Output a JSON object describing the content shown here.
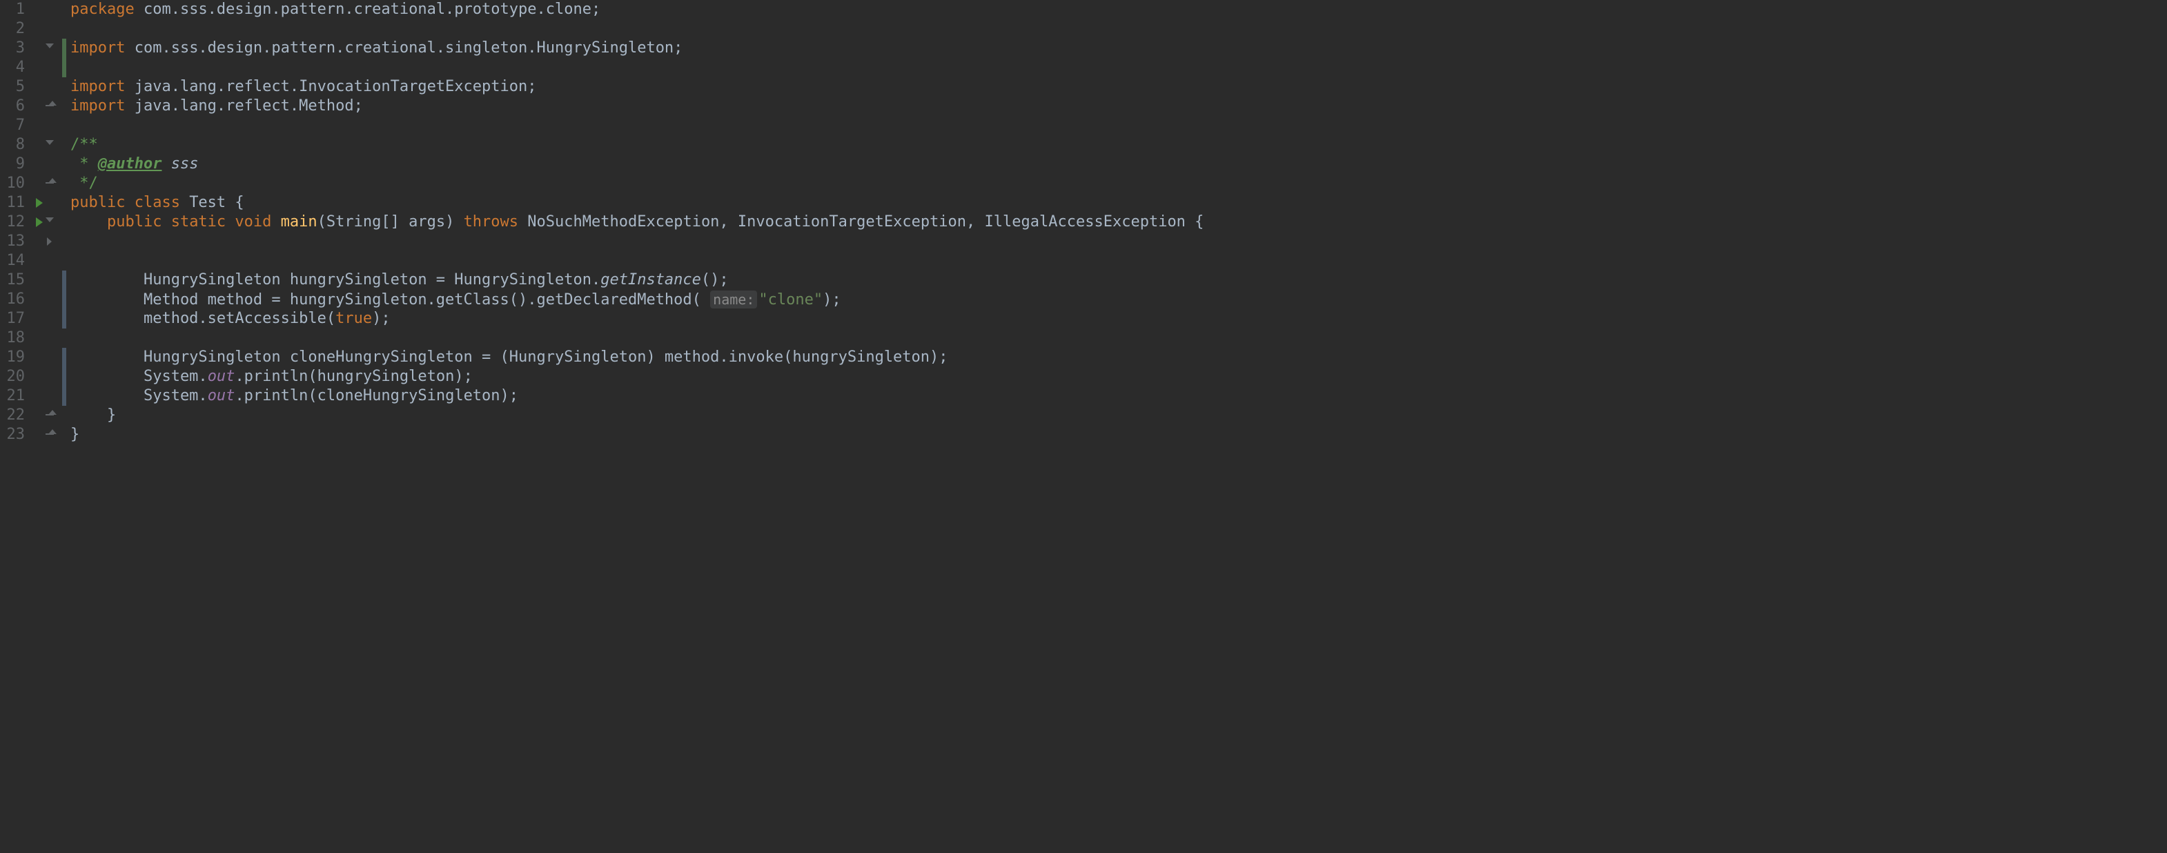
{
  "lines": [
    {
      "n": "1",
      "bar": "",
      "fold": "",
      "html": [
        [
          "kw",
          "package "
        ],
        [
          "",
          "com.sss.design.pattern.creational.prototype.clone;"
        ]
      ]
    },
    {
      "n": "2",
      "bar": "",
      "fold": "",
      "html": [
        [
          "",
          ""
        ]
      ]
    },
    {
      "n": "3",
      "bar": "green",
      "fold": "open",
      "html": [
        [
          "kw",
          "import "
        ],
        [
          "",
          "com.sss.design.pattern.creational.singleton.HungrySingleton;"
        ]
      ]
    },
    {
      "n": "4",
      "bar": "green",
      "fold": "",
      "html": [
        [
          "",
          ""
        ]
      ]
    },
    {
      "n": "5",
      "bar": "",
      "fold": "",
      "html": [
        [
          "kw",
          "import "
        ],
        [
          "",
          "java.lang.reflect.InvocationTargetException;"
        ]
      ]
    },
    {
      "n": "6",
      "bar": "",
      "fold": "close",
      "html": [
        [
          "kw",
          "import "
        ],
        [
          "",
          "java.lang.reflect.Method;"
        ]
      ]
    },
    {
      "n": "7",
      "bar": "",
      "fold": "",
      "html": [
        [
          "",
          ""
        ]
      ]
    },
    {
      "n": "8",
      "bar": "",
      "fold": "open",
      "html": [
        [
          "doc",
          "/**"
        ]
      ]
    },
    {
      "n": "9",
      "bar": "",
      "fold": "",
      "html": [
        [
          "doc",
          " * "
        ],
        [
          "tag",
          "@author"
        ],
        [
          "doc",
          " "
        ],
        [
          "ital",
          "sss"
        ]
      ]
    },
    {
      "n": "10",
      "bar": "",
      "fold": "close",
      "html": [
        [
          "doc",
          " */"
        ]
      ]
    },
    {
      "n": "11",
      "bar": "",
      "fold": "run",
      "html": [
        [
          "kw",
          "public class "
        ],
        [
          "",
          "Test {"
        ]
      ]
    },
    {
      "n": "12",
      "bar": "",
      "fold": "run-open",
      "html": [
        [
          "",
          "    "
        ],
        [
          "kw",
          "public static void "
        ],
        [
          "def",
          "main"
        ],
        [
          "",
          "(String[] args) "
        ],
        [
          "kw",
          "throws "
        ],
        [
          "",
          "NoSuchMethodException, InvocationTargetException, IllegalAccessException {"
        ]
      ]
    },
    {
      "n": "13",
      "bar": "",
      "fold": "closed",
      "html": [
        [
          "",
          ""
        ]
      ]
    },
    {
      "n": "14",
      "bar": "",
      "fold": "",
      "html": [
        [
          "",
          ""
        ]
      ]
    },
    {
      "n": "15",
      "bar": "blue",
      "fold": "",
      "html": [
        [
          "",
          "        HungrySingleton hungrySingleton = HungrySingleton."
        ],
        [
          "ital",
          "getInstance"
        ],
        [
          "",
          "();"
        ]
      ]
    },
    {
      "n": "16",
      "bar": "blue",
      "fold": "",
      "html": [
        [
          "",
          "        Method method = hungrySingleton.getClass().getDeclaredMethod( "
        ],
        [
          "hint",
          "name:"
        ],
        [
          "str",
          "\"clone\""
        ],
        [
          "",
          ");"
        ]
      ]
    },
    {
      "n": "17",
      "bar": "blue",
      "fold": "",
      "html": [
        [
          "",
          "        method.setAccessible("
        ],
        [
          "kw",
          "true"
        ],
        [
          "",
          ");"
        ]
      ]
    },
    {
      "n": "18",
      "bar": "",
      "fold": "",
      "html": [
        [
          "",
          ""
        ]
      ]
    },
    {
      "n": "19",
      "bar": "blue",
      "fold": "",
      "html": [
        [
          "",
          "        HungrySingleton cloneHungrySingleton = (HungrySingleton) method.invoke(hungrySingleton);"
        ]
      ]
    },
    {
      "n": "20",
      "bar": "blue",
      "fold": "",
      "html": [
        [
          "",
          "        System."
        ],
        [
          "sital",
          "out"
        ],
        [
          "",
          ".println(hungrySingleton);"
        ]
      ]
    },
    {
      "n": "21",
      "bar": "blue",
      "fold": "",
      "html": [
        [
          "",
          "        System."
        ],
        [
          "sital",
          "out"
        ],
        [
          "",
          ".println(cloneHungrySingleton);"
        ]
      ]
    },
    {
      "n": "22",
      "bar": "",
      "fold": "close",
      "html": [
        [
          "",
          "    }"
        ]
      ]
    },
    {
      "n": "23",
      "bar": "",
      "fold": "close",
      "html": [
        [
          "",
          "}"
        ]
      ]
    }
  ]
}
